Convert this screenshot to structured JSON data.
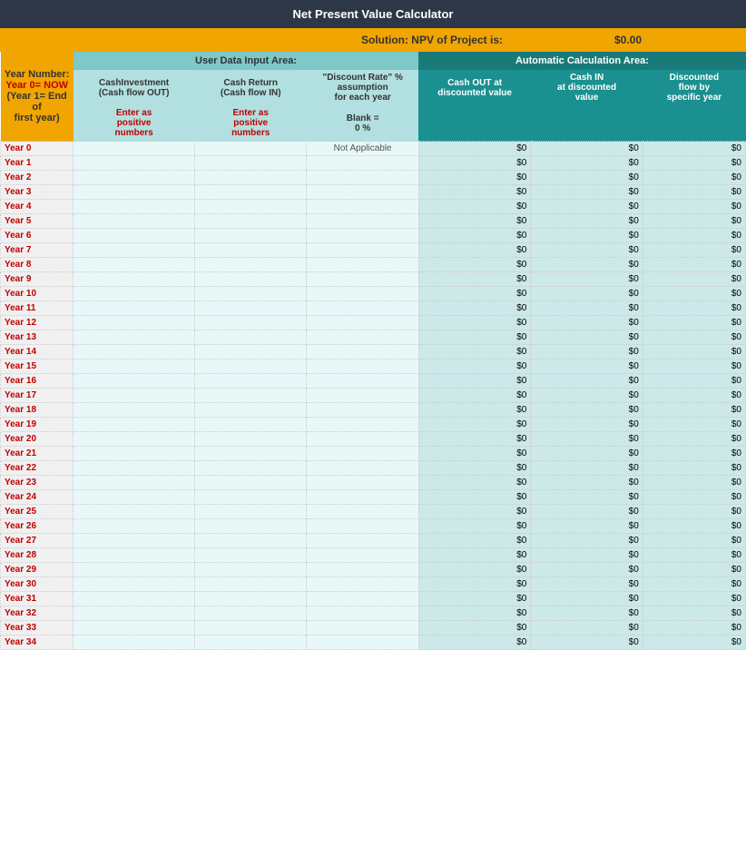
{
  "title": "Net Present Value Calculator",
  "solution": {
    "label": "Solution: NPV of Project is:",
    "value": "$0.00"
  },
  "headers": {
    "user_area": "User Data Input Area:",
    "auto_area": "Automatic Calculation Area:"
  },
  "columns": {
    "year_info": [
      "Year Number:",
      "Year 0= NOW",
      "(Year 1= End of",
      "first year)"
    ],
    "investment": [
      "CashInvestment",
      "(Cash flow OUT)",
      "",
      "Enter as positive numbers"
    ],
    "cash_return": [
      "Cash Return",
      "(Cash flow IN)",
      "",
      "Enter as positive numbers"
    ],
    "discount": [
      "\"Discount Rate\" %",
      "assumption",
      "for each year",
      "Blank =",
      "0 %"
    ],
    "cash_out": [
      "Cash OUT at",
      "discounted value"
    ],
    "cash_in": [
      "Cash IN",
      "at discounted",
      "value"
    ],
    "disc_flow": [
      "Discounted",
      "flow by",
      "specific year"
    ]
  },
  "rows": [
    {
      "year": "Year 0",
      "not_applicable": true
    },
    {
      "year": "Year 1"
    },
    {
      "year": "Year 2"
    },
    {
      "year": "Year 3"
    },
    {
      "year": "Year 4"
    },
    {
      "year": "Year 5"
    },
    {
      "year": "Year 6"
    },
    {
      "year": "Year 7"
    },
    {
      "year": "Year 8"
    },
    {
      "year": "Year 9"
    },
    {
      "year": "Year 10"
    },
    {
      "year": "Year 11"
    },
    {
      "year": "Year 12"
    },
    {
      "year": "Year 13"
    },
    {
      "year": "Year 14"
    },
    {
      "year": "Year 15"
    },
    {
      "year": "Year 16"
    },
    {
      "year": "Year 17"
    },
    {
      "year": "Year 18"
    },
    {
      "year": "Year 19"
    },
    {
      "year": "Year 20"
    },
    {
      "year": "Year 21"
    },
    {
      "year": "Year 22"
    },
    {
      "year": "Year 23"
    },
    {
      "year": "Year 24"
    },
    {
      "year": "Year 25"
    },
    {
      "year": "Year 26"
    },
    {
      "year": "Year 27"
    },
    {
      "year": "Year 28"
    },
    {
      "year": "Year 29"
    },
    {
      "year": "Year 30"
    },
    {
      "year": "Year 31"
    },
    {
      "year": "Year 32"
    },
    {
      "year": "Year 33"
    },
    {
      "year": "Year 34"
    }
  ],
  "default_calc_value": "$0",
  "not_applicable_text": "Not Applicable"
}
